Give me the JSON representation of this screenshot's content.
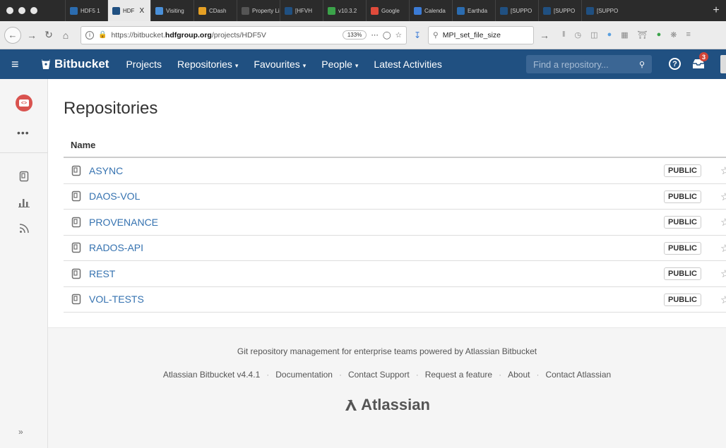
{
  "browser": {
    "tabs": [
      {
        "label": "HDF5 1",
        "color": "#2b6cb0"
      },
      {
        "label": "HDF",
        "color": "#205081",
        "active": true
      },
      {
        "label": "Visiting",
        "color": "#4a90d9"
      },
      {
        "label": "CDash",
        "color": "#e5a024"
      },
      {
        "label": "Property Lis",
        "color": "#555555"
      },
      {
        "label": "[HFVH",
        "color": "#205081"
      },
      {
        "label": "v10.3.2",
        "color": "#3ba34a"
      },
      {
        "label": "Google",
        "color": "#e04b3b"
      },
      {
        "label": "Calenda",
        "color": "#3b7bd6"
      },
      {
        "label": "Earthda",
        "color": "#2b6cb0"
      },
      {
        "label": "[SUPPO",
        "color": "#205081"
      },
      {
        "label": "[SUPPO",
        "color": "#205081"
      },
      {
        "label": "[SUPPO",
        "color": "#205081"
      }
    ],
    "url_prefix": "https://bitbucket.",
    "url_domain": "hdfgroup.org",
    "url_path": "/projects/HDF5V",
    "zoom": "133%",
    "search_value": "MPI_set_file_size",
    "tab_close": "X",
    "new_tab": "+"
  },
  "header": {
    "logo_text": "Bitbucket",
    "menu": [
      {
        "label": "Projects",
        "dropdown": false
      },
      {
        "label": "Repositories",
        "dropdown": true
      },
      {
        "label": "Favourites",
        "dropdown": true
      },
      {
        "label": "People",
        "dropdown": true
      },
      {
        "label": "Latest Activities",
        "dropdown": false
      }
    ],
    "search_placeholder": "Find a repository...",
    "notification_count": "3"
  },
  "page": {
    "title": "Repositories",
    "column_name": "Name",
    "repositories": [
      {
        "name": "ASYNC",
        "visibility": "PUBLIC"
      },
      {
        "name": "DAOS-VOL",
        "visibility": "PUBLIC"
      },
      {
        "name": "PROVENANCE",
        "visibility": "PUBLIC"
      },
      {
        "name": "RADOS-API",
        "visibility": "PUBLIC"
      },
      {
        "name": "REST",
        "visibility": "PUBLIC"
      },
      {
        "name": "VOL-TESTS",
        "visibility": "PUBLIC"
      }
    ]
  },
  "footer": {
    "tagline": "Git repository management for enterprise teams powered by Atlassian Bitbucket",
    "links": [
      "Atlassian Bitbucket v4.4.1",
      "Documentation",
      "Contact Support",
      "Request a feature",
      "About",
      "Contact Atlassian"
    ],
    "logo_text": "Atlassian"
  },
  "colors": {
    "header_bg": "#205081",
    "link": "#3572b0",
    "project_avatar": "#d9534f",
    "badge": "#d04437"
  }
}
